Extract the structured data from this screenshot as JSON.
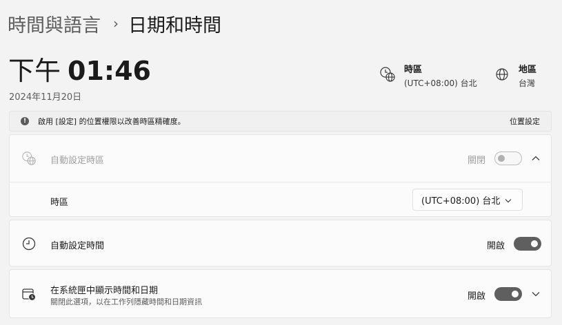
{
  "breadcrumb": {
    "parent": "時間與語言",
    "separator": "›",
    "current": "日期和時間"
  },
  "clock": {
    "ampm": "下午",
    "time": "01:46",
    "date": "2024年11月20日"
  },
  "timezone_info": {
    "title": "時區",
    "value": "(UTC+08:00) 台北"
  },
  "region_info": {
    "title": "地區",
    "value": "台灣"
  },
  "banner": {
    "text": "啟用 [設定] 的位置權限以改善時區精確度。",
    "link": "位置設定"
  },
  "auto_timezone": {
    "label": "自動設定時區",
    "state_text": "關閉",
    "enabled": false
  },
  "timezone_select": {
    "label": "時區",
    "value": "(UTC+08:00) 台北"
  },
  "auto_time": {
    "label": "自動設定時間",
    "state_text": "開啟",
    "enabled": true
  },
  "tray_time": {
    "label": "在系統匣中顯示時間和日期",
    "description": "關閉此選項，以在工作列隱藏時間和日期資訊",
    "state_text": "開啟",
    "enabled": true
  }
}
